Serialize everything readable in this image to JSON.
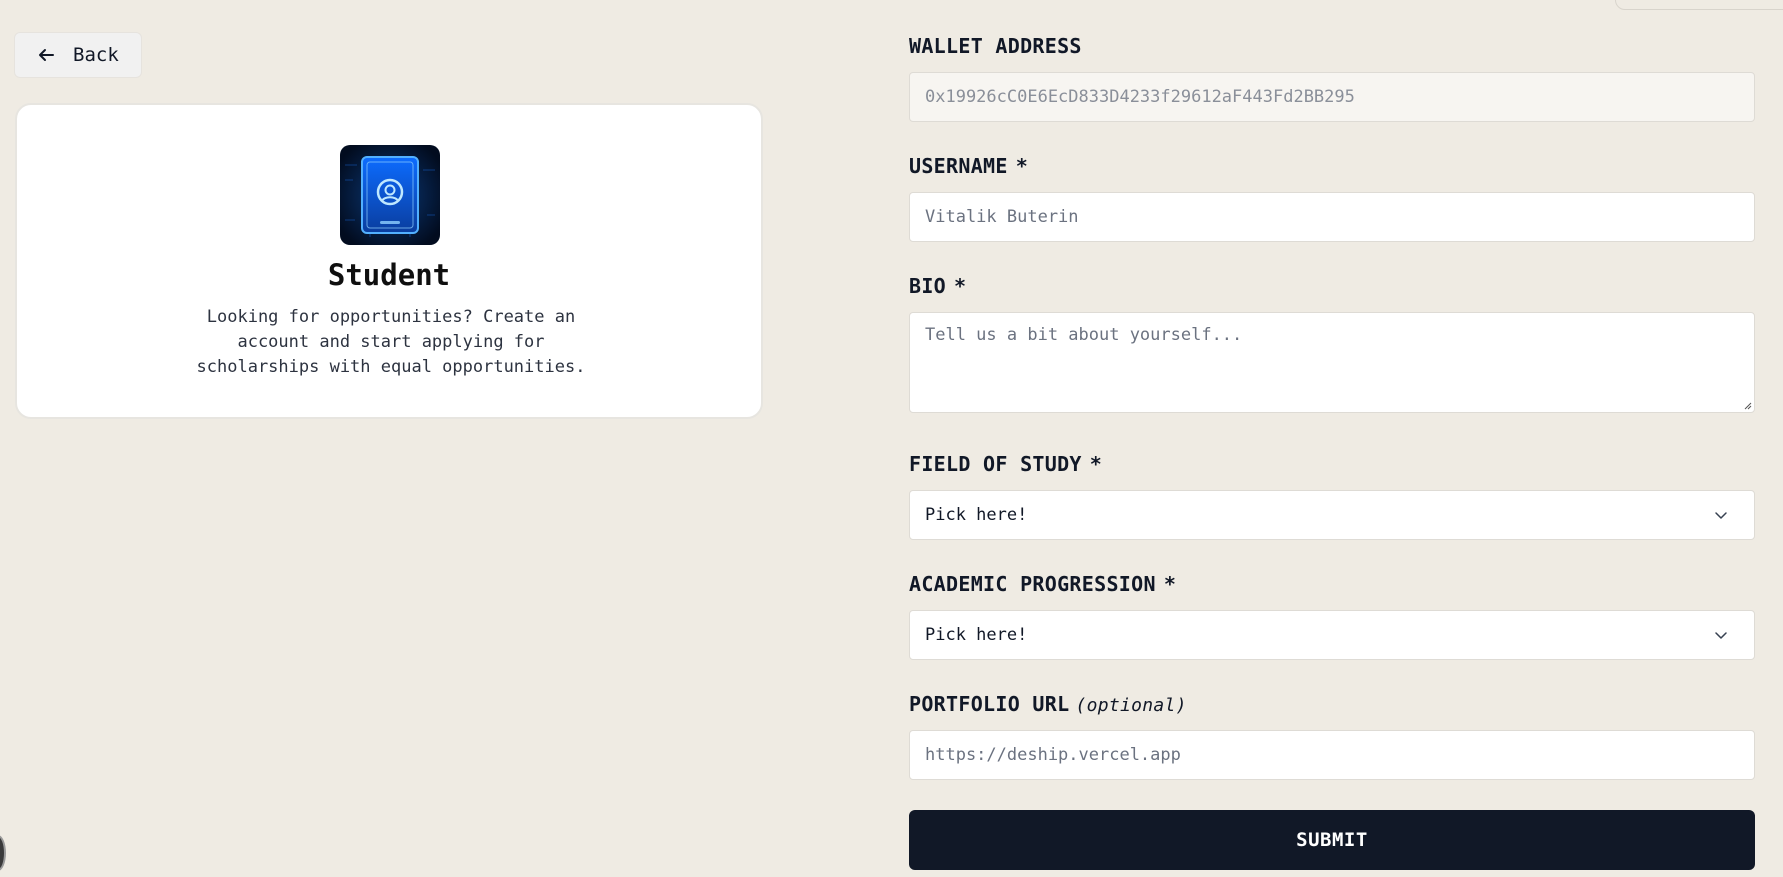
{
  "back_button": {
    "label": "Back"
  },
  "role_card": {
    "title": "Student",
    "description": "Looking for opportunities? Create an account and start applying for scholarships with equal opportunities."
  },
  "form": {
    "wallet_address": {
      "label": "WALLET ADDRESS",
      "value": "0x19926cC0E6EcD833D4233f29612aF443Fd2BB295"
    },
    "username": {
      "label": "USERNAME",
      "required_mark": "*",
      "placeholder": "Vitalik Buterin"
    },
    "bio": {
      "label": "BIO",
      "required_mark": "*",
      "placeholder": "Tell us a bit about yourself..."
    },
    "field_of_study": {
      "label": "FIELD OF STUDY",
      "required_mark": "*",
      "selected": "Pick here!"
    },
    "academic_progression": {
      "label": "ACADEMIC PROGRESSION",
      "required_mark": "*",
      "selected": "Pick here!"
    },
    "portfolio_url": {
      "label": "PORTFOLIO URL",
      "optional_note": "(optional)",
      "placeholder": "https://deship.vercel.app"
    },
    "submit_label": "SUBMIT"
  },
  "colors": {
    "page_background": "#efebe3",
    "submit_background": "#111827",
    "icon_glow": "#1e90ff"
  }
}
